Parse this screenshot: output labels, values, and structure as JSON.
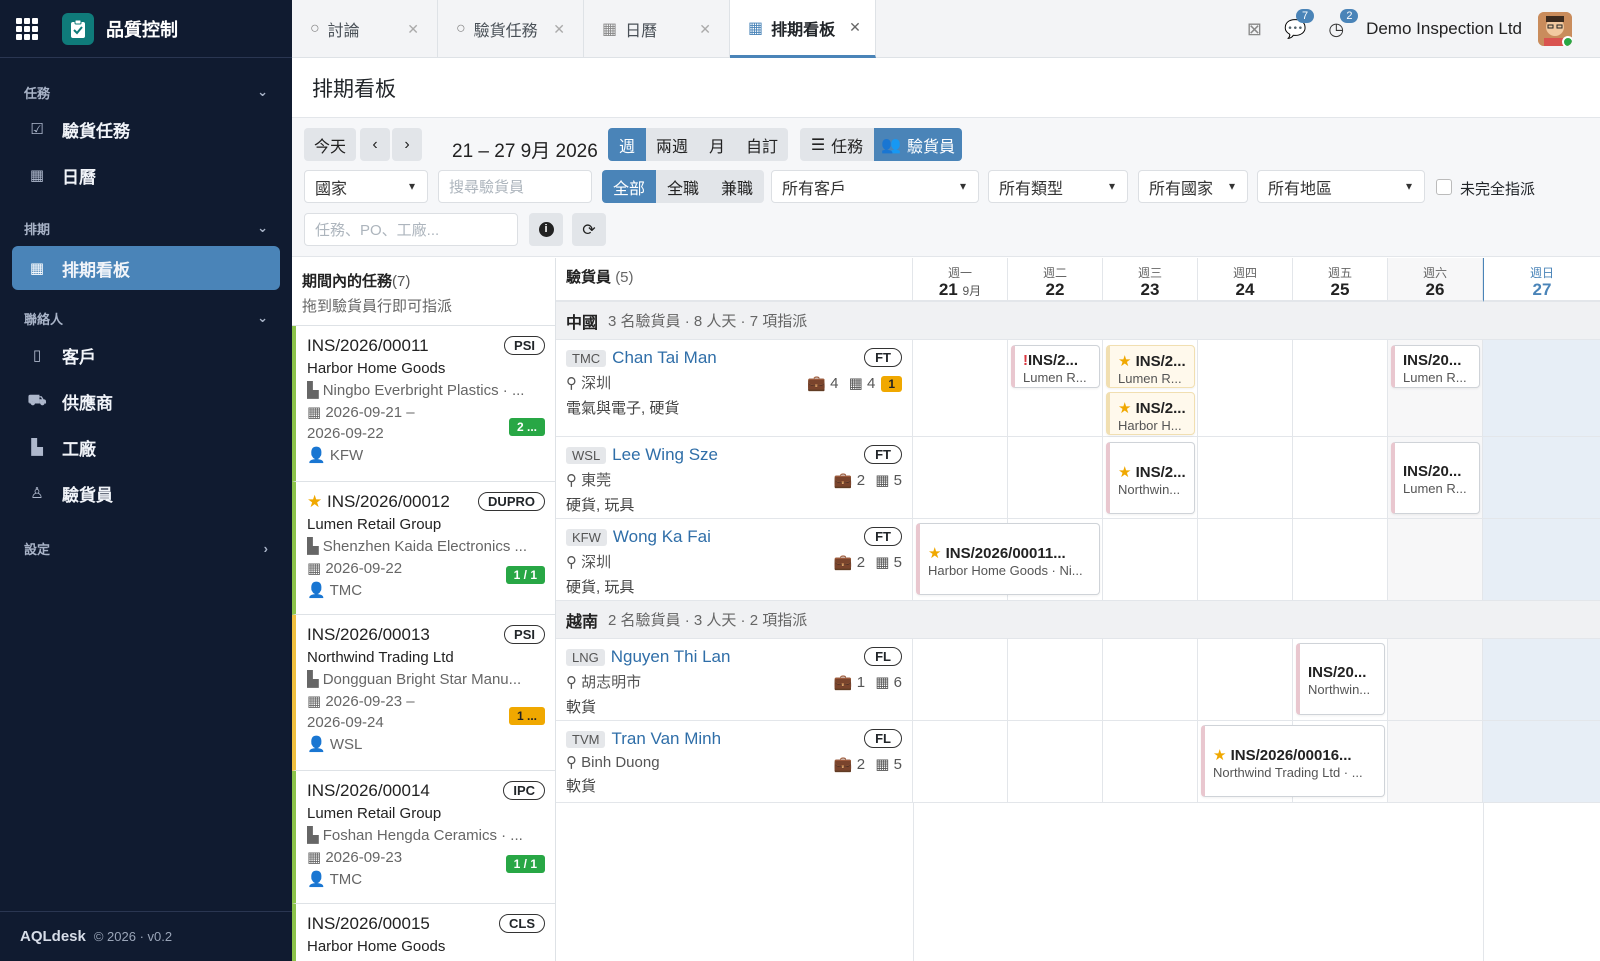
{
  "app": {
    "title": "品質控制",
    "footer_brand": "AQLdesk",
    "footer_meta": "© 2026 · v0.2",
    "accent_color": "#4a84b8"
  },
  "sidebar": {
    "sections": [
      {
        "label": "任務",
        "items": [
          {
            "label": "驗貨任務",
            "icon": "checkbox-icon"
          },
          {
            "label": "日曆",
            "icon": "calendar-icon"
          }
        ]
      },
      {
        "label": "排期",
        "items": [
          {
            "label": "排期看板",
            "icon": "grid-icon",
            "active": true
          }
        ]
      },
      {
        "label": "聯絡人",
        "items": [
          {
            "label": "客戶",
            "icon": "building-icon"
          },
          {
            "label": "供應商",
            "icon": "truck-icon"
          },
          {
            "label": "工廠",
            "icon": "factory-icon"
          },
          {
            "label": "驗貨員",
            "icon": "user-tie-icon"
          }
        ]
      },
      {
        "label": "設定",
        "items": []
      }
    ]
  },
  "tabs": [
    {
      "label": "討論",
      "icon": "circle-icon"
    },
    {
      "label": "驗貨任務",
      "icon": "circle-icon"
    },
    {
      "label": "日曆",
      "icon": "calendar-icon"
    },
    {
      "label": "排期看板",
      "icon": "grid-icon",
      "active": true
    }
  ],
  "topbar": {
    "messages_count": "7",
    "activity_count": "2",
    "company": "Demo Inspection Ltd"
  },
  "page": {
    "title": "排期看板"
  },
  "toolbar": {
    "today": "今天",
    "date_range": "21 – 27 9月 2026",
    "views": [
      "週",
      "兩週",
      "月",
      "自訂"
    ],
    "active_view": "週",
    "mode_tasks": "任務",
    "mode_inspectors": "驗貨員",
    "country_select": "國家",
    "inspector_search_placeholder": "搜尋驗貨員",
    "employment": [
      "全部",
      "全職",
      "兼職"
    ],
    "client_filter": "所有客戶",
    "type_filter": "所有類型",
    "country_filter": "所有國家",
    "region_filter": "所有地區",
    "unassigned_label": "未完全指派",
    "task_search_placeholder": "任務、PO、工廠..."
  },
  "tasklist": {
    "title": "期間內的任務",
    "count": "(7)",
    "hint": "拖到驗貨員行即可指派",
    "tasks": [
      {
        "code": "INS/2026/00011",
        "type": "PSI",
        "client": "Harbor Home Goods",
        "factory": "Ningbo Everbright Plastics · ...",
        "date1": "2026-09-21 –",
        "date2": "2026-09-22",
        "inspector": "KFW",
        "ratio": "2 ...",
        "starred": false
      },
      {
        "code": "INS/2026/00012",
        "type": "DUPRO",
        "client": "Lumen Retail Group",
        "factory": "Shenzhen Kaida Electronics ...",
        "date1": "2026-09-22",
        "date2": "",
        "inspector": "TMC",
        "ratio": "1 / 1",
        "starred": true
      },
      {
        "code": "INS/2026/00013",
        "type": "PSI",
        "client": "Northwind Trading Ltd",
        "factory": "Dongguan Bright Star Manu...",
        "date1": "2026-09-23 –",
        "date2": "2026-09-24",
        "inspector": "WSL",
        "ratio": "1 ...",
        "starred": false
      },
      {
        "code": "INS/2026/00014",
        "type": "IPC",
        "client": "Lumen Retail Group",
        "factory": "Foshan Hengda Ceramics · ...",
        "date1": "2026-09-23",
        "date2": "",
        "inspector": "TMC",
        "ratio": "1 / 1",
        "starred": false
      },
      {
        "code": "INS/2026/00015",
        "type": "CLS",
        "client": "Harbor Home Goods",
        "factory": "",
        "date1": "",
        "date2": "",
        "inspector": "",
        "ratio": "",
        "starred": false
      }
    ]
  },
  "grid": {
    "inspectors_header": "驗貨員",
    "inspectors_count": "(5)",
    "days": [
      {
        "dow": "週一",
        "day": "21",
        "month": "9月"
      },
      {
        "dow": "週二",
        "day": "22",
        "month": ""
      },
      {
        "dow": "週三",
        "day": "23",
        "month": ""
      },
      {
        "dow": "週四",
        "day": "24",
        "month": ""
      },
      {
        "dow": "週五",
        "day": "25",
        "month": ""
      },
      {
        "dow": "週六",
        "day": "26",
        "month": ""
      },
      {
        "dow": "週日",
        "day": "27",
        "month": ""
      }
    ],
    "groups": [
      {
        "name": "中國",
        "summary": "3 名驗貨員 · 8 人天 · 7 項指派"
      },
      {
        "name": "越南",
        "summary": "2 名驗貨員 · 3 人天 · 2 項指派"
      }
    ],
    "inspectors": [
      {
        "initials": "TMC",
        "name": "Chan Tai Man",
        "emp": "FT",
        "location": "深圳",
        "skills": "電氣與電子, 硬貨",
        "jobs": "4",
        "days": "4",
        "overbook": "1"
      },
      {
        "initials": "WSL",
        "name": "Lee Wing Sze",
        "emp": "FT",
        "location": "東莞",
        "skills": "硬貨, 玩具",
        "jobs": "2",
        "days": "5",
        "overbook": ""
      },
      {
        "initials": "KFW",
        "name": "Wong Ka Fai",
        "emp": "FT",
        "location": "深圳",
        "skills": "硬貨, 玩具",
        "jobs": "2",
        "days": "5",
        "overbook": ""
      },
      {
        "initials": "LNG",
        "name": "Nguyen Thi Lan",
        "emp": "FL",
        "location": "胡志明市",
        "skills": "軟貨",
        "jobs": "1",
        "days": "6",
        "overbook": ""
      },
      {
        "initials": "TVM",
        "name": "Tran Van Minh",
        "emp": "FL",
        "location": "Binh Duong",
        "skills": "軟貨",
        "jobs": "2",
        "days": "5",
        "overbook": ""
      }
    ],
    "events": [
      {
        "code": "INS/2...",
        "sub": "Lumen R...",
        "flag": "!"
      },
      {
        "code": "INS/2...",
        "sub": "Lumen R...",
        "flag": "star"
      },
      {
        "code": "INS/2...",
        "sub": "Harbor H...",
        "flag": "star"
      },
      {
        "code": "INS/20...",
        "sub": "Lumen R...",
        "flag": ""
      },
      {
        "code": "INS/2...",
        "sub": "Northwin...",
        "flag": "star"
      },
      {
        "code": "INS/20...",
        "sub": "Lumen R...",
        "flag": ""
      },
      {
        "code": "INS/2026/00011...",
        "sub": "Harbor Home Goods · Ni...",
        "flag": "star"
      },
      {
        "code": "INS/20...",
        "sub": "Northwin...",
        "flag": ""
      },
      {
        "code": "INS/2026/00016...",
        "sub": "Northwind Trading Ltd · ...",
        "flag": "star"
      }
    ]
  }
}
